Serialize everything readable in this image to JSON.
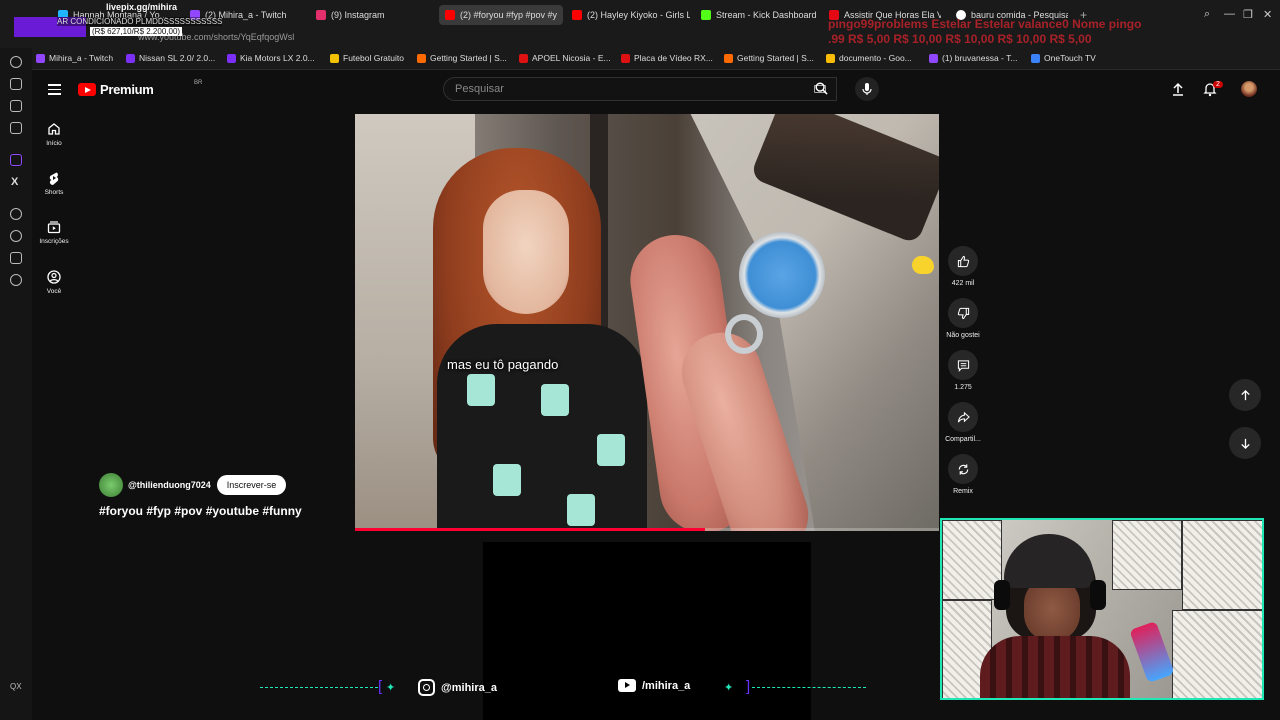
{
  "browser": {
    "tabs": [
      {
        "label": "Hannah Montana / Yo...",
        "color": "#1fb6ff"
      },
      {
        "label": "(2) Mihira_a - Twitch",
        "color": "#9146ff"
      },
      {
        "label": "(9) Instagram",
        "color": "#e1306c"
      },
      {
        "label": "(2) #foryou #fyp #pov #y",
        "color": "#ff0000"
      },
      {
        "label": "(2) Hayley Kiyoko - Girls L",
        "color": "#ff0000"
      },
      {
        "label": "Stream - Kick Dashboard",
        "color": "#53fc18"
      },
      {
        "label": "Assistir Que Horas Ela Vo",
        "color": "#e50914"
      },
      {
        "label": "bauru comida - Pesquisa",
        "color": "#ffffff"
      }
    ],
    "url": "www.youtube.com/shorts/YqEqfqogWsl",
    "bookmarks": [
      {
        "label": "Mihira_a - Twitch",
        "color": "#9146ff"
      },
      {
        "label": "Nissan SL 2.0/ 2.0...",
        "color": "#7b2ff7"
      },
      {
        "label": "Kia Motors LX 2.0...",
        "color": "#7b2ff7"
      },
      {
        "label": "Futebol Gratuito",
        "color": "#f2c200"
      },
      {
        "label": "Getting Started | S...",
        "color": "#ff6a00"
      },
      {
        "label": "APOEL Nicosia - E...",
        "color": "#d11"
      },
      {
        "label": "Placa de Vídeo RX...",
        "color": "#d11"
      },
      {
        "label": "Getting Started | S...",
        "color": "#ff6a00"
      },
      {
        "label": "documento - Goo...",
        "color": "#fbbc05"
      },
      {
        "label": "(1) bruvanessa - T...",
        "color": "#9146ff"
      },
      {
        "label": "OneTouch TV",
        "color": "#3b82f6"
      }
    ]
  },
  "stream_overlay": {
    "site": "livepix.gg/mihira",
    "alert_line1": "AR CONDICIONADO PLMDDSSSSSSSSSSS",
    "alert_line2": "(R$ 627,10/R$ 2.200,00)",
    "tips_line1": "pingo99problems   Estelar   Estelar   valance0   Nome   pingo",
    "tips_line2": ".99  R$ 5,00          R$ 10,00   R$ 10,00   R$ 10,00   R$ 5,00"
  },
  "yt": {
    "brand": "Premium",
    "country": "BR",
    "search_placeholder": "Pesquisar",
    "notif_count": "2",
    "nav": [
      {
        "label": "Início"
      },
      {
        "label": "Shorts"
      },
      {
        "label": "Inscrições"
      },
      {
        "label": "Você"
      }
    ],
    "subtitle": "mas eu tô pagando",
    "progress": 0.6,
    "channel": "@thilienduong7024",
    "subscribe": "Inscrever-se",
    "hashtags": "#foryou #fyp #pov #youtube #funny",
    "actions": {
      "like_count": "422 mil",
      "dislike_label": "Não gostei",
      "comments_count": "1.275",
      "share_label": "Compartil...",
      "remix_label": "Remix"
    }
  },
  "social": {
    "instagram": "@mihira_a",
    "youtube": "/mihira_a"
  },
  "corner": "QX"
}
